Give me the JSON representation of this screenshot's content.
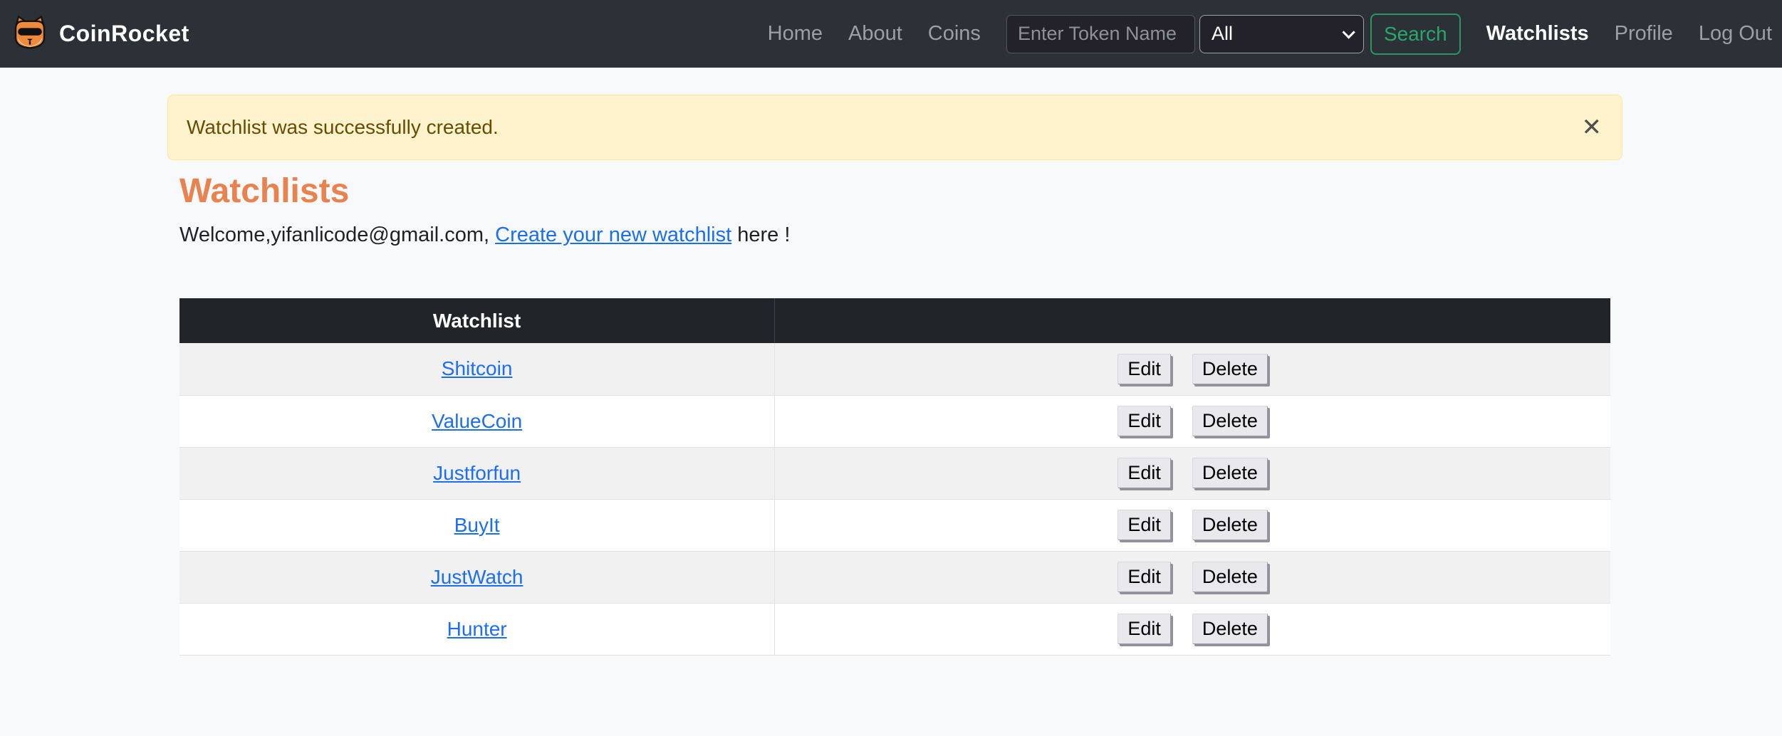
{
  "brand": {
    "name": "CoinRocket"
  },
  "nav": {
    "links": [
      {
        "label": "Home"
      },
      {
        "label": "About"
      },
      {
        "label": "Coins"
      }
    ],
    "search": {
      "placeholder": "Enter Token Name",
      "filter_value": "All",
      "button_label": "Search"
    },
    "account_links": [
      {
        "label": "Watchlists",
        "active": true
      },
      {
        "label": "Profile",
        "active": false
      },
      {
        "label": "Log Out",
        "active": false
      }
    ]
  },
  "alert": {
    "message": "Watchlist was successfully created.",
    "close_glyph": "✕"
  },
  "page": {
    "title": "Watchlists",
    "welcome_prefix": "Welcome,yifanlicode@gmail.com, ",
    "welcome_link_label": "Create your new watchlist",
    "welcome_suffix": " here !"
  },
  "watchlist_table": {
    "header_label": "Watchlist",
    "rows": [
      {
        "name": "Shitcoin"
      },
      {
        "name": "ValueCoin"
      },
      {
        "name": "Justforfun"
      },
      {
        "name": "BuyIt"
      },
      {
        "name": "JustWatch"
      },
      {
        "name": "Hunter"
      }
    ],
    "actions": {
      "edit_label": "Edit",
      "delete_label": "Delete"
    }
  },
  "colors": {
    "navbar_bg": "#2b3137",
    "table_header_bg": "#212529",
    "accent_orange": "#e8824f",
    "link_blue": "#1a6ef5",
    "search_green": "#2aa76a",
    "alert_bg": "#fff3cd",
    "alert_text": "#664d03"
  }
}
